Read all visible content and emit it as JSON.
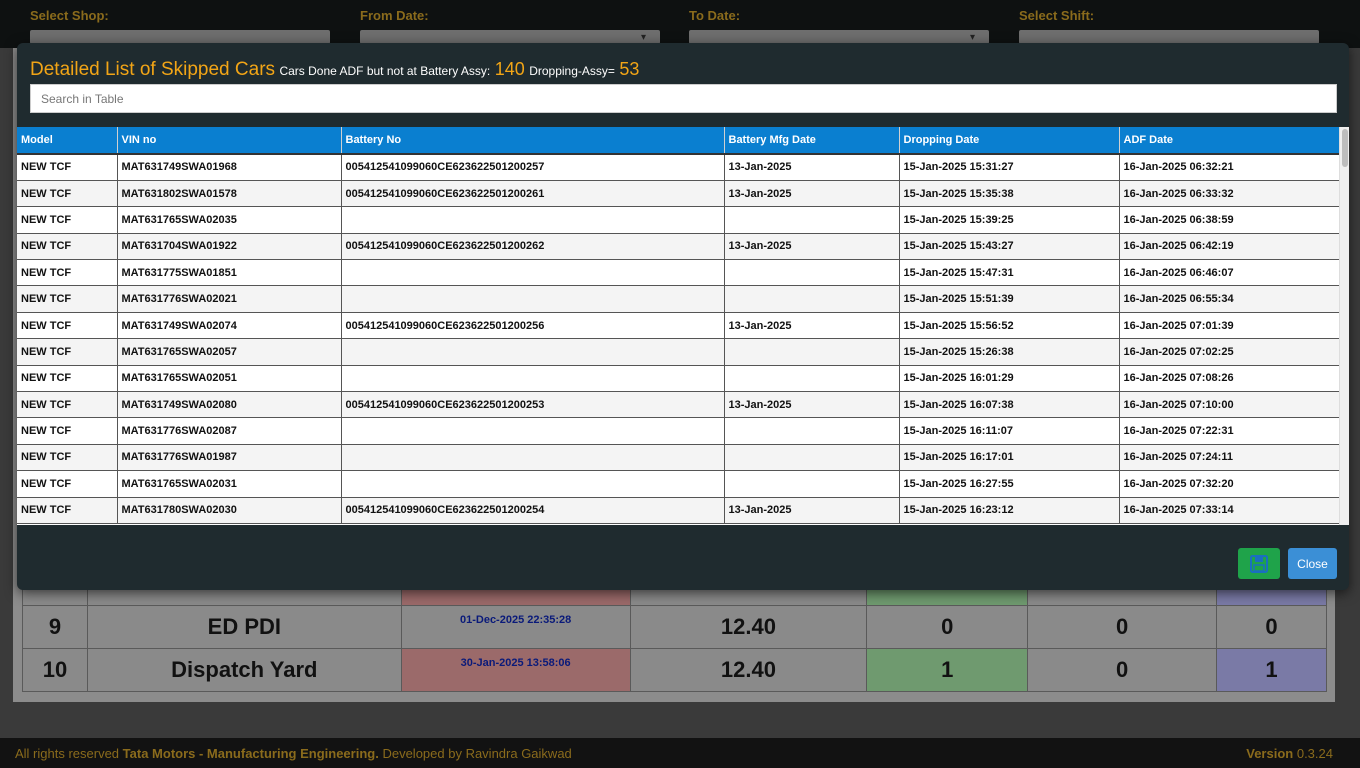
{
  "filters": {
    "shop_label": "Select Shop:",
    "from_label": "From Date:",
    "to_label": "To Date:",
    "shift_label": "Select Shift:"
  },
  "background_table": {
    "rows": [
      {
        "no": "9",
        "station": "ED PDI",
        "timestamp": "01-Dec-2025 22:35:28",
        "jph": "12.40",
        "c1": "0",
        "c2": "0",
        "c3": "0"
      },
      {
        "no": "10",
        "station": "Dispatch Yard",
        "timestamp": "30-Jan-2025 13:58:06",
        "jph": "12.40",
        "c1": "1",
        "c2": "0",
        "c3": "1"
      }
    ]
  },
  "modal": {
    "title": "Detailed List of Skipped Cars",
    "subtitle_prefix": "Cars Done ADF but not at Battery Assy:",
    "skipped_count": "140",
    "dropping_label": "Dropping-Assy=",
    "dropping_count": "53",
    "search_placeholder": "Search in Table",
    "columns": [
      "Model",
      "VIN no",
      "Battery No",
      "Battery Mfg Date",
      "Dropping Date",
      "ADF Date"
    ],
    "rows": [
      [
        "NEW TCF",
        "MAT631749SWA01968",
        "005412541099060CE623622501200257",
        "13-Jan-2025",
        "15-Jan-2025 15:31:27",
        "16-Jan-2025 06:32:21"
      ],
      [
        "NEW TCF",
        "MAT631802SWA01578",
        "005412541099060CE623622501200261",
        "13-Jan-2025",
        "15-Jan-2025 15:35:38",
        "16-Jan-2025 06:33:32"
      ],
      [
        "NEW TCF",
        "MAT631765SWA02035",
        "",
        "",
        "15-Jan-2025 15:39:25",
        "16-Jan-2025 06:38:59"
      ],
      [
        "NEW TCF",
        "MAT631704SWA01922",
        "005412541099060CE623622501200262",
        "13-Jan-2025",
        "15-Jan-2025 15:43:27",
        "16-Jan-2025 06:42:19"
      ],
      [
        "NEW TCF",
        "MAT631775SWA01851",
        "",
        "",
        "15-Jan-2025 15:47:31",
        "16-Jan-2025 06:46:07"
      ],
      [
        "NEW TCF",
        "MAT631776SWA02021",
        "",
        "",
        "15-Jan-2025 15:51:39",
        "16-Jan-2025 06:55:34"
      ],
      [
        "NEW TCF",
        "MAT631749SWA02074",
        "005412541099060CE623622501200256",
        "13-Jan-2025",
        "15-Jan-2025 15:56:52",
        "16-Jan-2025 07:01:39"
      ],
      [
        "NEW TCF",
        "MAT631765SWA02057",
        "",
        "",
        "15-Jan-2025 15:26:38",
        "16-Jan-2025 07:02:25"
      ],
      [
        "NEW TCF",
        "MAT631765SWA02051",
        "",
        "",
        "15-Jan-2025 16:01:29",
        "16-Jan-2025 07:08:26"
      ],
      [
        "NEW TCF",
        "MAT631749SWA02080",
        "005412541099060CE623622501200253",
        "13-Jan-2025",
        "15-Jan-2025 16:07:38",
        "16-Jan-2025 07:10:00"
      ],
      [
        "NEW TCF",
        "MAT631776SWA02087",
        "",
        "",
        "15-Jan-2025 16:11:07",
        "16-Jan-2025 07:22:31"
      ],
      [
        "NEW TCF",
        "MAT631776SWA01987",
        "",
        "",
        "15-Jan-2025 16:17:01",
        "16-Jan-2025 07:24:11"
      ],
      [
        "NEW TCF",
        "MAT631765SWA02031",
        "",
        "",
        "15-Jan-2025 16:27:55",
        "16-Jan-2025 07:32:20"
      ],
      [
        "NEW TCF",
        "MAT631780SWA02030",
        "005412541099060CE623622501200254",
        "13-Jan-2025",
        "15-Jan-2025 16:23:12",
        "16-Jan-2025 07:33:14"
      ]
    ],
    "save_icon": "floppy-disk-icon",
    "close_label": "Close"
  },
  "footer": {
    "prefix": "All rights reserved",
    "company": "Tata Motors - Manufacturing Engineering.",
    "developer": "Developed by Ravindra Gaikwad",
    "version_label": "Version",
    "version": "0.3.24"
  },
  "colors": {
    "accent": "#f2a516",
    "header_blue": "#0a7fd0",
    "modal_bg": "#1f2b2f",
    "save_green": "#1fa34a",
    "close_blue": "#3b8fd6"
  }
}
